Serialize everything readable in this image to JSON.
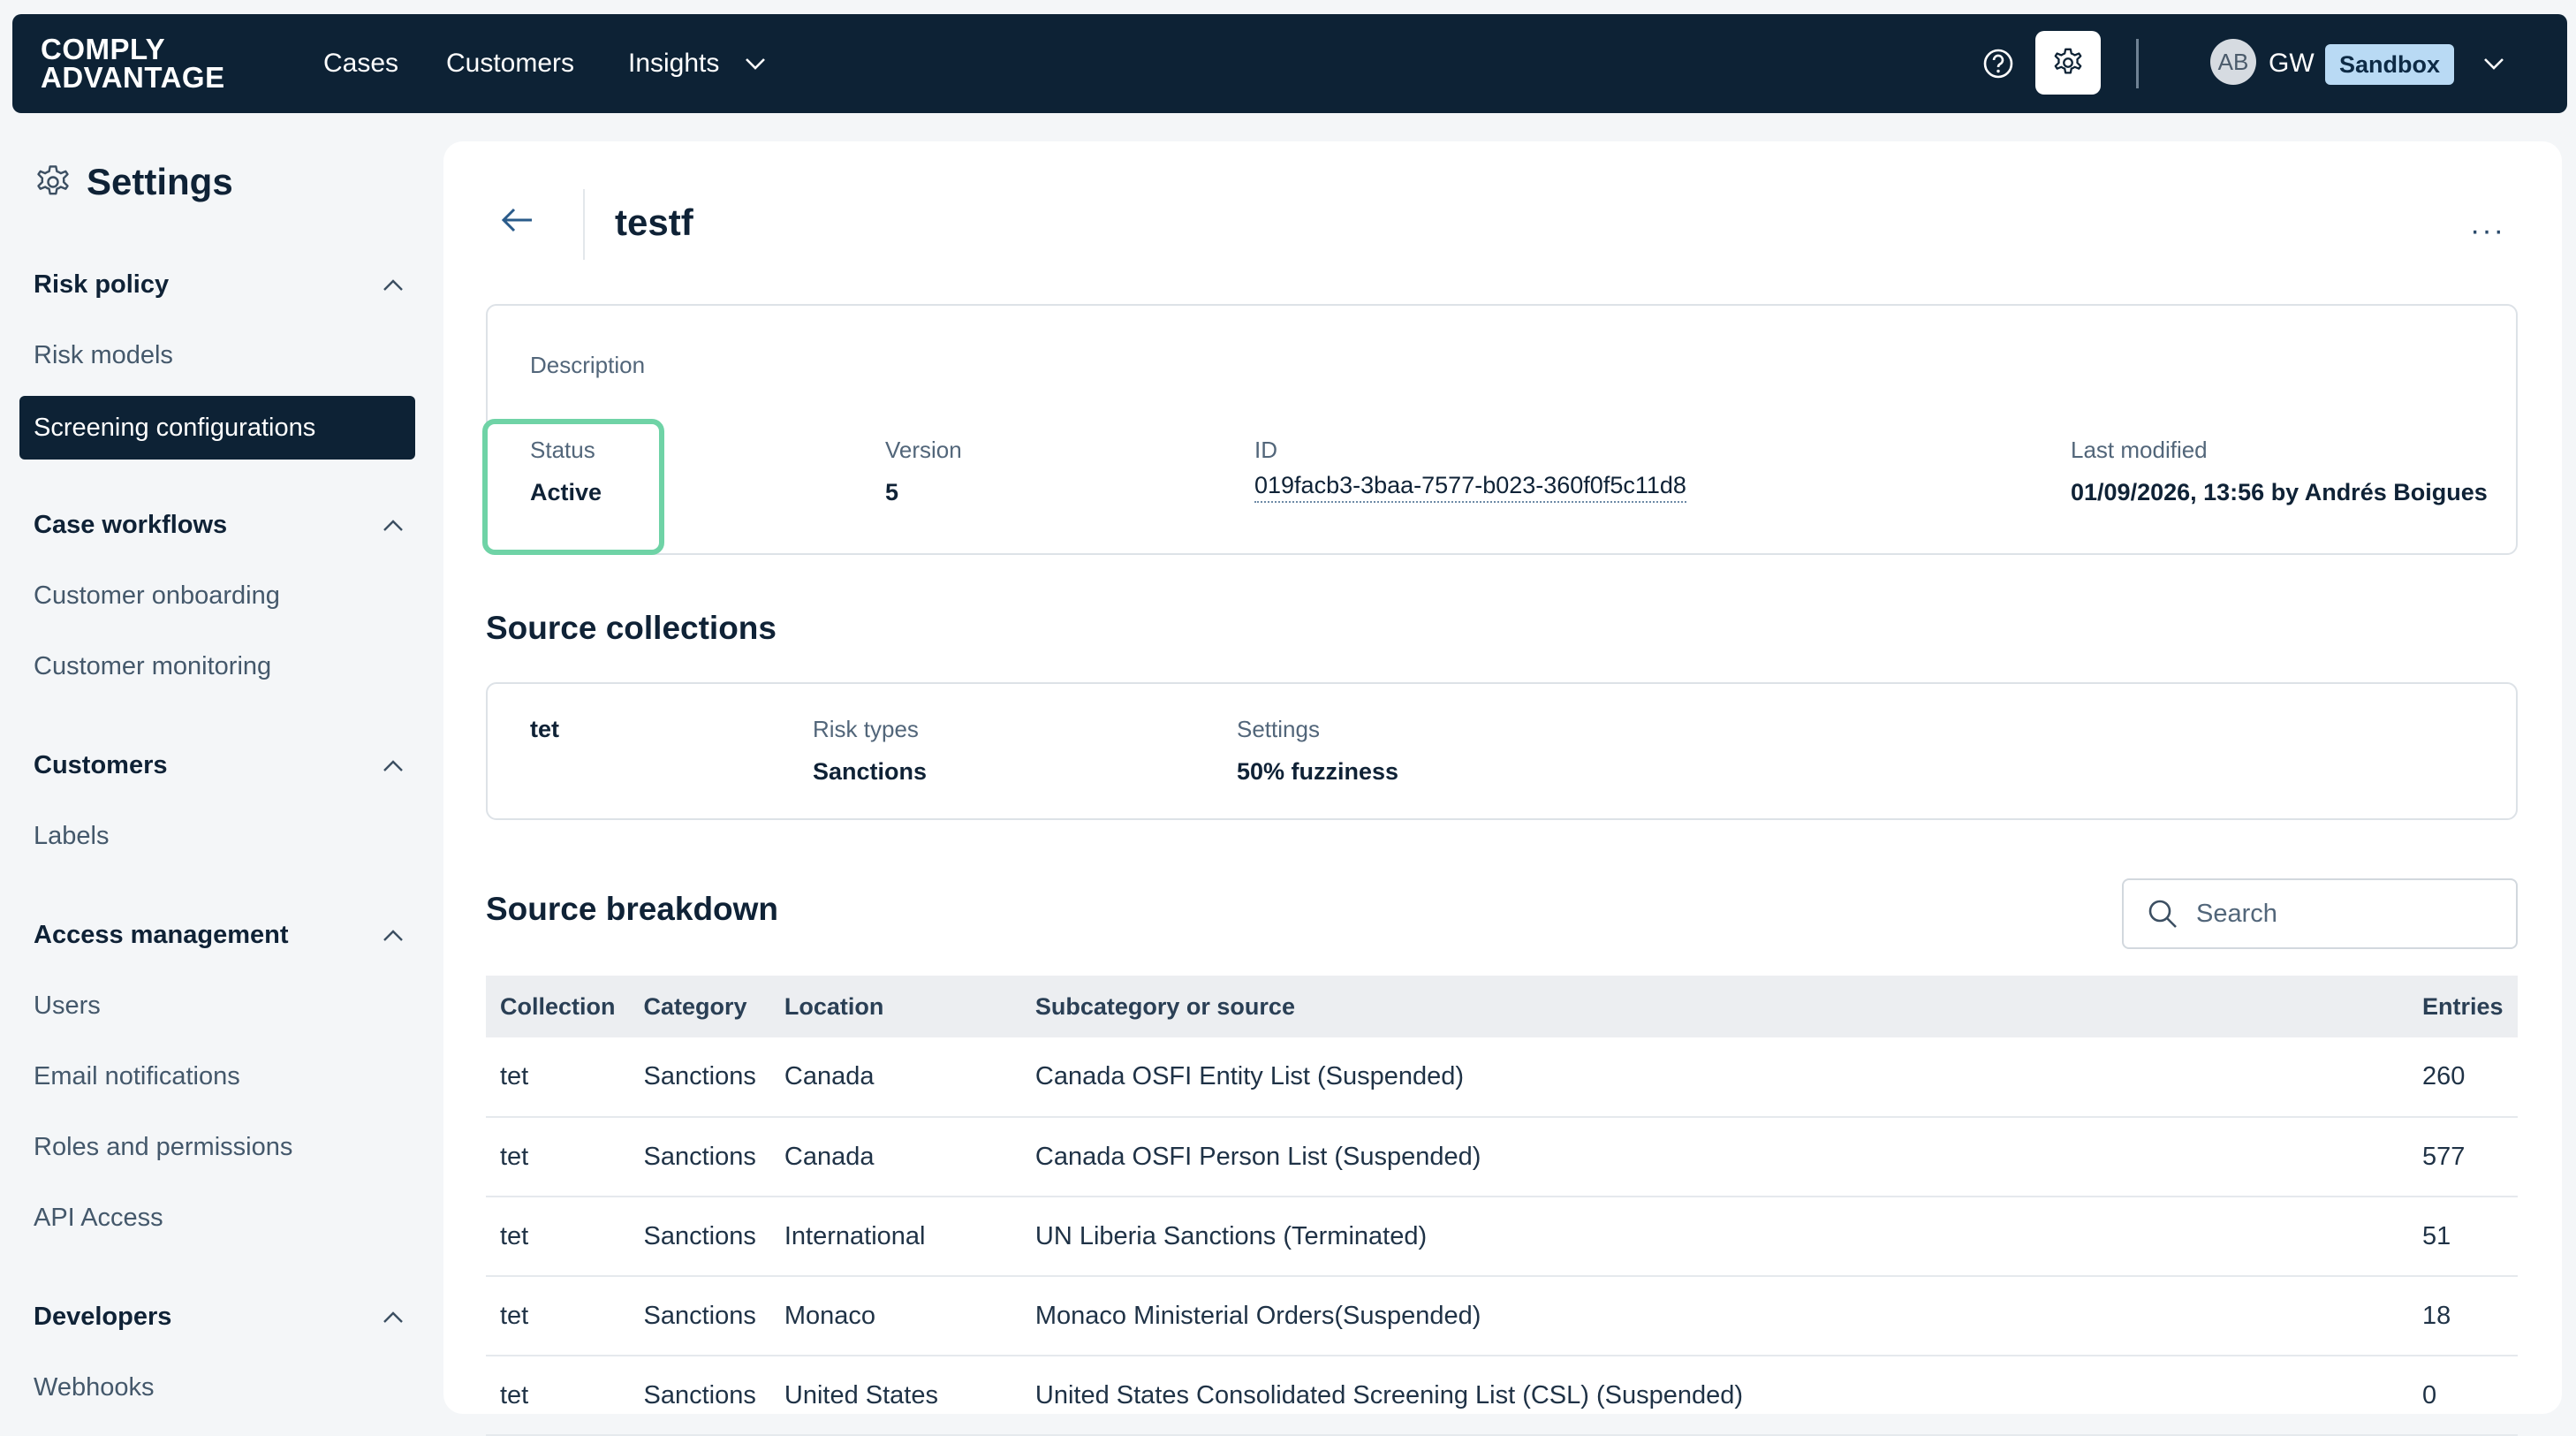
{
  "topbar": {
    "logo_line1": "COMPLY",
    "logo_line2": "ADVANTAGE",
    "nav": {
      "cases": "Cases",
      "customers": "Customers",
      "insights": "Insights"
    },
    "avatar": "AB",
    "user_initials": "GW",
    "environment_badge": "Sandbox",
    "icons": [
      "help-icon",
      "gear-icon",
      "chevron-down-icon"
    ]
  },
  "sidebar": {
    "title": "Settings",
    "sections": [
      {
        "header": "Risk policy",
        "items": [
          "Risk models",
          "Screening configurations"
        ]
      },
      {
        "header": "Case workflows",
        "items": [
          "Customer onboarding",
          "Customer monitoring"
        ]
      },
      {
        "header": "Customers",
        "items": [
          "Labels"
        ]
      },
      {
        "header": "Access management",
        "items": [
          "Users",
          "Email notifications",
          "Roles and permissions",
          "API Access"
        ]
      },
      {
        "header": "Developers",
        "items": [
          "Webhooks"
        ]
      }
    ],
    "active_item": "Screening configurations"
  },
  "main": {
    "title": "testf",
    "more_label": "···",
    "info": {
      "description_label": "Description",
      "status_label": "Status",
      "status_value": "Active",
      "version_label": "Version",
      "version_value": "5",
      "id_label": "ID",
      "id_value": "019facb3-3baa-7577-b023-360f0f5c11d8",
      "modified_label": "Last modified",
      "modified_value": "01/09/2026, 13:56 by Andrés Boigues"
    },
    "source_collections": {
      "title": "Source collections",
      "name": "tet",
      "risk_types_label": "Risk types",
      "risk_types_value": "Sanctions",
      "settings_label": "Settings",
      "settings_value": "50% fuzziness"
    },
    "source_breakdown": {
      "title": "Source breakdown",
      "search_placeholder": "Search",
      "columns": [
        "Collection",
        "Category",
        "Location",
        "Subcategory or source",
        "Entries"
      ],
      "rows": [
        [
          "tet",
          "Sanctions",
          "Canada",
          "Canada OSFI Entity List (Suspended)",
          "260"
        ],
        [
          "tet",
          "Sanctions",
          "Canada",
          "Canada OSFI Person List (Suspended)",
          "577"
        ],
        [
          "tet",
          "Sanctions",
          "International",
          "UN Liberia Sanctions (Terminated)",
          "51"
        ],
        [
          "tet",
          "Sanctions",
          "Monaco",
          "Monaco Ministerial Orders(Suspended)",
          "18"
        ],
        [
          "tet",
          "Sanctions",
          "United States",
          "United States Consolidated Screening List (CSL) (Suspended)",
          "0"
        ]
      ]
    }
  }
}
